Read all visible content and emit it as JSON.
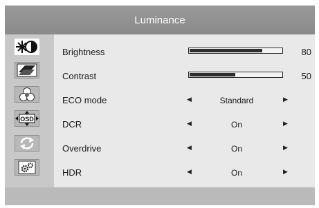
{
  "title": "Luminance",
  "sidebar": {
    "items": [
      {
        "icon": "brightness-icon",
        "active": true
      },
      {
        "icon": "picture-icon",
        "active": false
      },
      {
        "icon": "color-icon",
        "active": false
      },
      {
        "icon": "osd-icon",
        "label": "OSD",
        "active": false
      },
      {
        "icon": "reset-icon",
        "active": false
      },
      {
        "icon": "settings-icon",
        "active": false
      }
    ]
  },
  "rows": {
    "brightness": {
      "label": "Brightness",
      "value": "80",
      "level": 0.8
    },
    "contrast": {
      "label": "Contrast",
      "value": "50",
      "level": 0.5
    },
    "eco": {
      "label": "ECO mode",
      "value": "Standard"
    },
    "dcr": {
      "label": "DCR",
      "value": "On"
    },
    "overdrive": {
      "label": "Overdrive",
      "value": "On"
    },
    "hdr": {
      "label": "HDR",
      "value": "On"
    }
  },
  "arrows": {
    "left": "◀",
    "right": "▶"
  },
  "colors": {
    "header": "#919191",
    "content_bg": "#e9e9e9",
    "sidebar_bg": "#c8c8c8",
    "bar_fill": "#2e2e2e"
  }
}
